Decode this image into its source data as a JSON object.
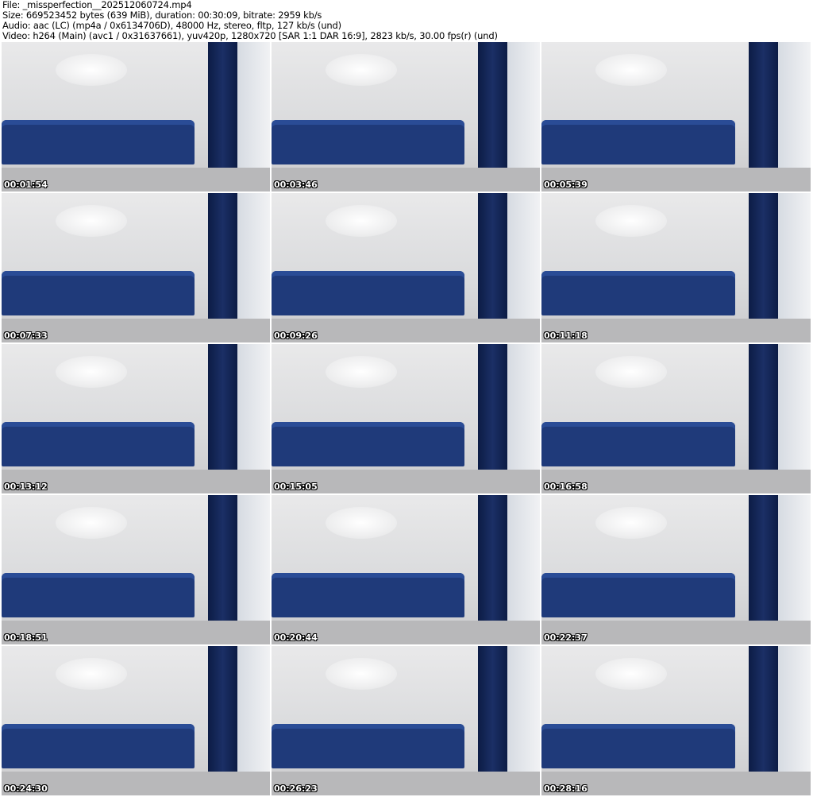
{
  "header": {
    "file": "File: _missperfection__202512060724.mp4",
    "size": "Size: 669523452 bytes (639 MiB), duration: 00:30:09, bitrate: 2959 kb/s",
    "audio": "Audio: aac (LC) (mp4a / 0x6134706D), 48000 Hz, stereo, fltp, 127 kb/s (und)",
    "video": "Video: h264 (Main) (avc1 / 0x31637661), yuv420p, 1280x720 [SAR 1:1 DAR 16:9], 2823 kb/s, 30.00 fps(r) (und)"
  },
  "thumbnails": [
    {
      "timestamp": "00:01:54"
    },
    {
      "timestamp": "00:03:46"
    },
    {
      "timestamp": "00:05:39"
    },
    {
      "timestamp": "00:07:33"
    },
    {
      "timestamp": "00:09:26"
    },
    {
      "timestamp": "00:11:18"
    },
    {
      "timestamp": "00:13:12"
    },
    {
      "timestamp": "00:15:05"
    },
    {
      "timestamp": "00:16:58"
    },
    {
      "timestamp": "00:18:51"
    },
    {
      "timestamp": "00:20:44"
    },
    {
      "timestamp": "00:22:37"
    },
    {
      "timestamp": "00:24:30"
    },
    {
      "timestamp": "00:26:23"
    },
    {
      "timestamp": "00:28:16"
    }
  ]
}
